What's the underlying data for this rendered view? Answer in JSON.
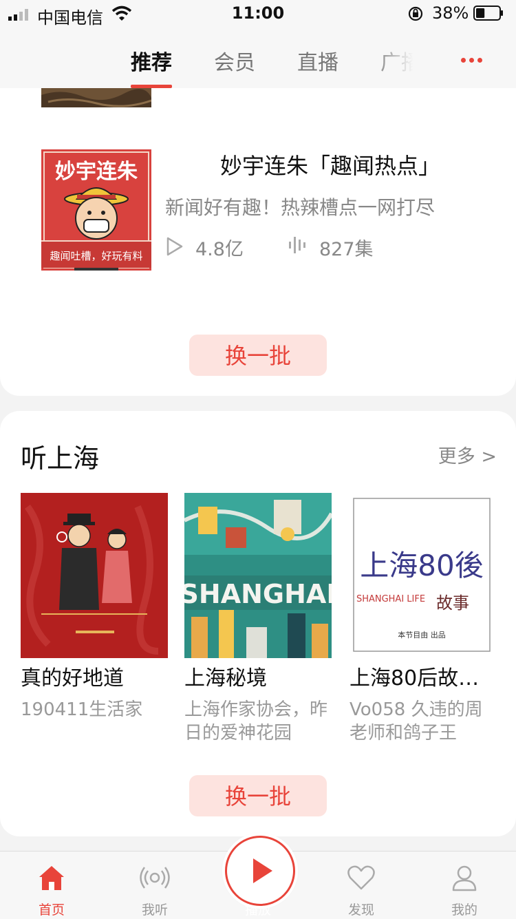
{
  "status_bar": {
    "carrier": "中国电信",
    "time": "11:00",
    "battery_percent": "38%",
    "battery_level": 0.38
  },
  "top_tabs": {
    "tabs": [
      "推荐",
      "会员",
      "直播",
      "广播"
    ],
    "active_index": 0
  },
  "recommend": {
    "show": {
      "title": "妙宇连朱「趣闻热点」",
      "description": "新闻好有趣！热辣槽点一网打尽",
      "play_count": "4.8亿",
      "episode_count": "827集",
      "cover_text_top": "妙宇连朱",
      "cover_text_bottom": "趣闻吐槽，好玩有料"
    },
    "refresh_label": "换一批"
  },
  "shanghai": {
    "title": "听上海",
    "more_label": "更多 >",
    "items": [
      {
        "title": "真的好地道",
        "subtitle": "190411生活家"
      },
      {
        "title": "上海秘境",
        "subtitle": "上海作家协会，昨日的爱神花园",
        "cover_text": "SHANGHAI"
      },
      {
        "title": "上海80后故…",
        "subtitle": "Vo058 久违的周老师和鸽子王",
        "cover_text_main": "上海80後",
        "cover_text_en": "SHANGHAI LIFE",
        "cover_text_story": "故事",
        "cover_footer": "本节目由 出品"
      }
    ],
    "refresh_label": "换一批"
  },
  "bottom_nav": {
    "items": [
      "首页",
      "我听",
      "播放",
      "发现",
      "我的"
    ],
    "active_index": 0
  },
  "colors": {
    "accent": "#e8443a",
    "accent_light": "#fde3df",
    "text_primary": "#111111",
    "text_secondary": "#888888"
  }
}
